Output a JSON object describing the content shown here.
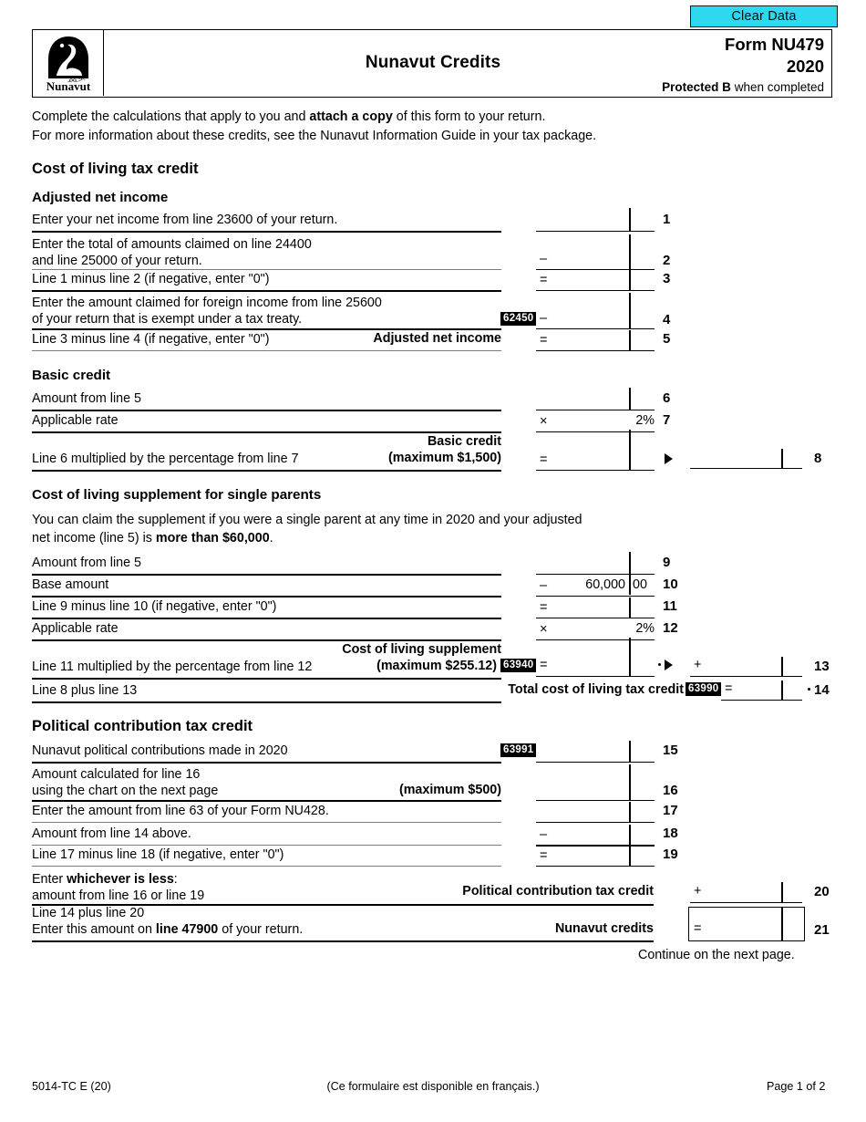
{
  "toolbar": {
    "clear_data_label": "Clear Data"
  },
  "header": {
    "logo_name": "Nunavut",
    "title": "Nunavut Credits",
    "form_number": "Form NU479",
    "year": "2020",
    "protected_bold": "Protected B",
    "protected_rest": " when completed"
  },
  "intro": {
    "line1_a": "Complete the calculations that apply to you and ",
    "line1_b": "attach a copy",
    "line1_c": " of this form to your return.",
    "line2": "For more information about these credits, see the Nunavut Information Guide in your tax package."
  },
  "sections": {
    "cost_of_living": "Cost of living tax credit",
    "adjusted_net_income": "Adjusted net income",
    "basic_credit": "Basic credit",
    "supplement": "Cost of living supplement for single parents",
    "political": "Political contribution tax credit"
  },
  "supplement_note": {
    "line1": "You can claim the supplement if you were a single parent at any time in 2020 and your adjusted",
    "line2_a": "net income (line 5) is ",
    "line2_b": "more than $60,000",
    "line2_c": "."
  },
  "lines": {
    "l1": {
      "no": "1",
      "label": "Enter your net income from line 23600 of your return."
    },
    "l2": {
      "no": "2",
      "label_a": "Enter the total of amounts claimed on line 24400",
      "label_b": "and line 25000 of your return.",
      "op": "–"
    },
    "l3": {
      "no": "3",
      "label": "Line 1 minus line 2 (if negative, enter \"0\")",
      "op": "="
    },
    "l4": {
      "no": "4",
      "label_a": "Enter the amount claimed for foreign income from line 25600",
      "label_b": "of your return that is exempt under a tax treaty.",
      "code": "62450",
      "op": "–"
    },
    "l5": {
      "no": "5",
      "label": "Line 3 minus line 4 (if negative, enter \"0\")",
      "caption": "Adjusted net income",
      "op": "="
    },
    "l6": {
      "no": "6",
      "label": "Amount from line 5"
    },
    "l7": {
      "no": "7",
      "label": "Applicable rate",
      "op": "×",
      "value": "2%"
    },
    "l8": {
      "no": "8",
      "label": "Line 6 multiplied by the percentage from line 7",
      "caption_a": "Basic credit",
      "caption_b": "(maximum $1,500)",
      "op": "="
    },
    "l9": {
      "no": "9",
      "label": "Amount from line 5"
    },
    "l10": {
      "no": "10",
      "label": "Base amount",
      "op": "–",
      "value_dollars": "60,000",
      "value_cents": "00"
    },
    "l11": {
      "no": "11",
      "label": "Line 9 minus line 10 (if negative, enter \"0\")",
      "op": "="
    },
    "l12": {
      "no": "12",
      "label": "Applicable rate",
      "op": "×",
      "value": "2%"
    },
    "l13": {
      "no": "13",
      "label": "Line 11 multiplied by the percentage from line 12",
      "caption_a": "Cost of living supplement",
      "caption_b": "(maximum $255.12)",
      "code": "63940",
      "op": "=",
      "op2": "+"
    },
    "l14": {
      "no": "14",
      "label": "Line 8 plus line 13",
      "caption": "Total cost of living tax credit",
      "code": "63990",
      "op": "="
    },
    "l15": {
      "no": "15",
      "label": "Nunavut political contributions made in 2020",
      "code": "63991"
    },
    "l16": {
      "no": "16",
      "label_a": "Amount calculated for line 16",
      "label_b": "using the chart on the next page",
      "caption": "(maximum $500)"
    },
    "l17": {
      "no": "17",
      "label": "Enter the amount from line 63 of your Form NU428."
    },
    "l18": {
      "no": "18",
      "label": "Amount from line 14 above.",
      "op": "–"
    },
    "l19": {
      "no": "19",
      "label": "Line 17 minus line 18 (if negative, enter \"0\")",
      "op": "="
    },
    "l20": {
      "no": "20",
      "label_a": "Enter ",
      "label_b": "whichever is less",
      "label_c": ":",
      "label_d": "amount from line 16 or line 19",
      "caption": "Political contribution tax credit",
      "op": "+"
    },
    "l21": {
      "no": "21",
      "label_a": "Line 14 plus line 20",
      "label_b1": "Enter this amount on ",
      "label_b2": "line 47900",
      "label_b3": " of your return.",
      "caption": "Nunavut credits",
      "op": "="
    }
  },
  "continue_note": "Continue on the next page.",
  "footer": {
    "left": "5014-TC E (20)",
    "center": "(Ce formulaire est disponible en français.)",
    "right": "Page 1 of 2"
  }
}
